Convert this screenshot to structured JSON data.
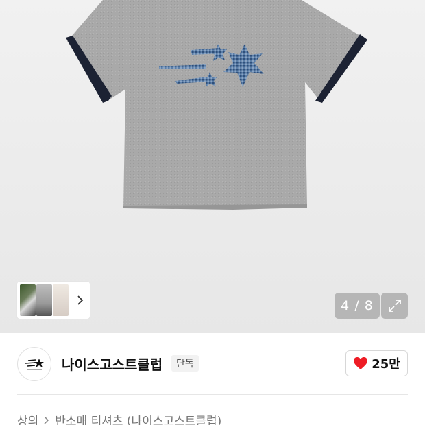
{
  "gallery": {
    "counter": "4 / 8"
  },
  "brand": {
    "name": "나이스고스트클럽",
    "badge": "단독"
  },
  "like": {
    "count": "25만"
  },
  "breadcrumb": {
    "category": "상의",
    "subcategory": "반소매 티셔츠 (나이스고스트클럽)"
  },
  "colors": {
    "heather_grey": "#a8a8a8",
    "trim_navy": "#1c2233",
    "print_blue": "#3a5f8e",
    "heart_red": "#ee1c25"
  }
}
